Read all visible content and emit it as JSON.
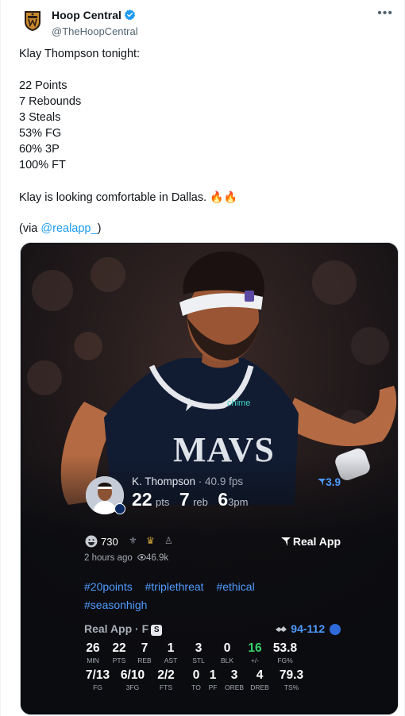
{
  "author": {
    "display_name": "Hoop Central",
    "handle": "@TheHoopCentral"
  },
  "tweet": {
    "intro": "Klay Thompson tonight:",
    "stats": [
      "22 Points",
      "7 Rebounds",
      "3 Steals",
      "53% FG",
      "60% 3P",
      "100% FT"
    ],
    "closing": "Klay is looking comfortable in Dallas.",
    "closing_emoji": "🔥🔥",
    "via_prefix": "(via ",
    "via_mention": "@realapp_",
    "via_suffix": ")"
  },
  "card": {
    "player_name": "K. Thompson",
    "separator": " · ",
    "fps": "40.9 fps",
    "rating": "3.9",
    "points": "22",
    "points_label": "pts",
    "rebounds": "7",
    "rebounds_label": "reb",
    "threes": "6",
    "threes_label": "3pm",
    "likes": "730",
    "real_app_label": "Real App",
    "time_ago": "2 hours ago",
    "views": "46.9k",
    "hashtags": [
      "#20points",
      "#triplethreat",
      "#ethical",
      "#seasonhigh"
    ],
    "box_title": "Real App · F",
    "box_badge": "S",
    "game_score": "94-112",
    "row1": [
      {
        "v": "26",
        "l": "MIN"
      },
      {
        "v": "22",
        "l": "PTS"
      },
      {
        "v": "7",
        "l": "REB"
      },
      {
        "v": "1",
        "l": "AST"
      },
      {
        "v": "3",
        "l": "STL"
      },
      {
        "v": "0",
        "l": "BLK"
      },
      {
        "v": "16",
        "l": "+/-"
      },
      {
        "v": "53.8",
        "l": "FG%"
      }
    ],
    "row2": [
      {
        "v": "7/13",
        "l": "FG"
      },
      {
        "v": "6/10",
        "l": "3FG"
      },
      {
        "v": "2/2",
        "l": "FTS"
      },
      {
        "v": "0",
        "l": "TO"
      },
      {
        "v": "1",
        "l": "PF"
      },
      {
        "v": "3",
        "l": "OREB"
      },
      {
        "v": "4",
        "l": "DREB"
      },
      {
        "v": "79.3",
        "l": "TS%"
      }
    ]
  },
  "icons": {
    "more": "more-dots-icon",
    "verified": "verified-badge-icon",
    "brand_logo": "hoop-central-logo",
    "rating": "rating-chevron-icon",
    "real_app": "real-app-logo-icon",
    "views": "eye-icon"
  },
  "colors": {
    "link": "#1d9bf0",
    "card_accent": "#4f9bff",
    "plus_minus": "#37d36b",
    "card_bg": "#0b0c10"
  }
}
